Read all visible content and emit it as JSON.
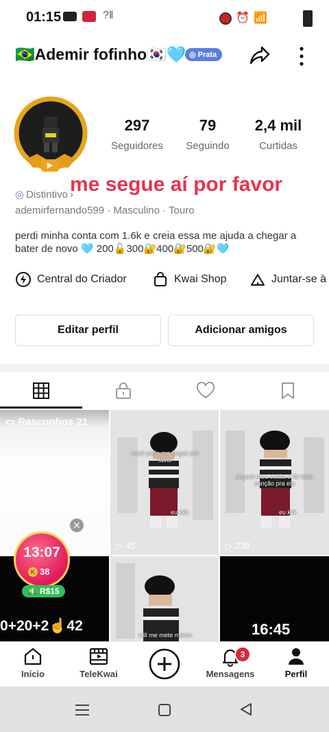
{
  "status_bar": {
    "time": "01:15"
  },
  "profile": {
    "display_name": "🇧🇷Ademir fofinho🇰🇷🩵",
    "rank_badge": "Prata",
    "stats": [
      {
        "value": "297",
        "label": "Seguidores"
      },
      {
        "value": "79",
        "label": "Seguindo"
      },
      {
        "value": "2,4 mil",
        "label": "Curtidas"
      }
    ],
    "overlay_text": "me segue aí por favor",
    "distintivo": "Distintivo",
    "username": "ademirfernando599",
    "gender": "Masculino",
    "sign": "Touro",
    "bio": "perdi minha conta com 1.6k e creia essa me ajuda a chegar a bater de novo 🩵 200🔓300🔐400🔐500🔐🩵"
  },
  "quick_links": [
    {
      "label": "Central do Criador",
      "icon": "lightning-circle-icon"
    },
    {
      "label": "Kwai Shop",
      "icon": "shopping-bag-icon"
    },
    {
      "label": "Juntar-se à",
      "icon": "tent-icon"
    }
  ],
  "actions": {
    "edit": "Editar perfil",
    "add_friends": "Adicionar amigos"
  },
  "tabs": [
    "grid-icon",
    "lock-icon",
    "heart-icon",
    "bookmark-icon"
  ],
  "grid": {
    "drafts_label": "Rascunhos 21",
    "timer": "13:07",
    "coins": "38",
    "reward": "R$15",
    "promo_text": "0+20+2☝️42",
    "cell2_caption": "você pode me seguir por favor",
    "cell2_sub": "eu kkk",
    "cell2_views": "45",
    "cell3_caption": "peguei meu violão e fiz essa canção pra ela",
    "cell3_sub": "eu kkk",
    "cell3_views": "238",
    "cell5_caption": "will me mete memo",
    "cell6_duration": "16:45"
  },
  "bottom_nav": [
    {
      "label": "Início",
      "icon": "home-icon"
    },
    {
      "label": "TeleKwai",
      "icon": "film-icon"
    },
    {
      "label": "",
      "icon": "plus-circle-icon"
    },
    {
      "label": "Mensagens",
      "icon": "bell-icon",
      "badge": "3"
    },
    {
      "label": "Perfil",
      "icon": "person-icon"
    }
  ],
  "colors": {
    "accent_red": "#e8334f",
    "badge_blue": "#5b7fe0",
    "notif_red": "#e0243a"
  }
}
